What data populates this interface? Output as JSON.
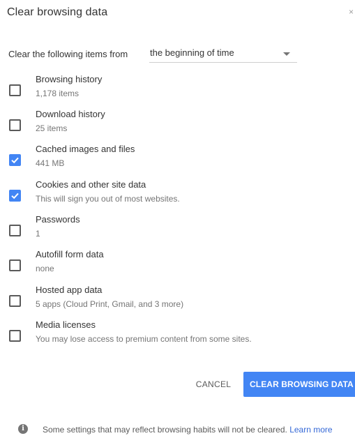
{
  "dialog": {
    "title": "Clear browsing data",
    "close_glyph": "×"
  },
  "range": {
    "label": "Clear the following items from",
    "selected": "the beginning of time"
  },
  "items": [
    {
      "title": "Browsing history",
      "subtitle": "1,178 items",
      "checked": false
    },
    {
      "title": "Download history",
      "subtitle": "25 items",
      "checked": false
    },
    {
      "title": "Cached images and files",
      "subtitle": "441 MB",
      "checked": true
    },
    {
      "title": "Cookies and other site data",
      "subtitle": "This will sign you out of most websites.",
      "checked": true
    },
    {
      "title": "Passwords",
      "subtitle": "1",
      "checked": false
    },
    {
      "title": "Autofill form data",
      "subtitle": "none",
      "checked": false
    },
    {
      "title": "Hosted app data",
      "subtitle": "5 apps (Cloud Print, Gmail, and 3 more)",
      "checked": false
    },
    {
      "title": "Media licenses",
      "subtitle": "You may lose access to premium content from some sites.",
      "checked": false
    }
  ],
  "buttons": {
    "cancel": "CANCEL",
    "clear": "CLEAR BROWSING DATA"
  },
  "footer": {
    "info_glyph": "i",
    "text": "Some settings that may reflect browsing habits will not be cleared.",
    "link_learn": "Learn",
    "link_more": "more"
  },
  "colors": {
    "accent": "#4285f4",
    "link": "#3367d6"
  }
}
